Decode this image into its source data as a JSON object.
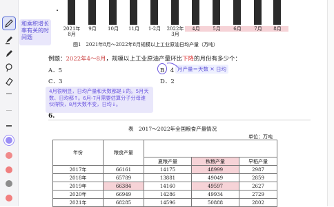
{
  "tooltip": {
    "text": "和乘积增长率有关的时间题"
  },
  "chart": {
    "x_labels": [
      "2021年\n8月",
      "9月",
      "10月",
      "11月",
      "1-2月",
      "2022年\n3月",
      "4月",
      "5月",
      "6月",
      "7月",
      "8月"
    ],
    "highlighted": [
      6,
      7,
      8,
      9,
      10
    ],
    "caption": "图1　2021年8月～2022年8月规模以上工业原油日均产量（万吨）"
  },
  "question": {
    "prefix": "例题：",
    "highlight": "2022年4～8月",
    "mid": "，规模以上工业原油产量环比",
    "red": "下降",
    "suffix": "的月份有多少个：",
    "options": [
      "A．5",
      "B．4",
      "C．3",
      "D．2"
    ]
  },
  "annotation": {
    "formula": "月产量＝天数 ✕ 日均"
  },
  "note": {
    "text": "4月很明显，日均产量和天数都是↓的。5月天数、日均都↑。6月-7月需要估算分子分母谁伙得快，8月天数不变，日均↓。"
  },
  "section_number": "6.",
  "table": {
    "title": "表　2017～2022年全国粮食产量情况",
    "unit": "单位：万吨",
    "headers": {
      "year": "年份",
      "grain": "粮食产量",
      "summer": "夏粮产量",
      "autumn": "秋粮产量",
      "early": "早稻产量"
    },
    "rows": [
      [
        "2017年",
        "66161",
        "14175",
        "48999",
        "2987"
      ],
      [
        "2018年",
        "65789",
        "13881",
        "49049",
        "2859"
      ],
      [
        "2019年",
        "66384",
        "14160",
        "49597",
        "2627"
      ],
      [
        "2020年",
        "66949",
        "14286",
        "49934",
        "2729"
      ],
      [
        "2021年",
        "68285",
        "14596",
        "50888",
        "2802"
      ]
    ]
  },
  "colors": {
    "accent": "#5b6fd6",
    "highlight": "#f6d3d7",
    "swatches": [
      "#9b8ef5",
      "#f08a8a",
      "#f07f7f",
      "#ee8585",
      "#8d8d8d",
      "#f27f7f"
    ]
  }
}
